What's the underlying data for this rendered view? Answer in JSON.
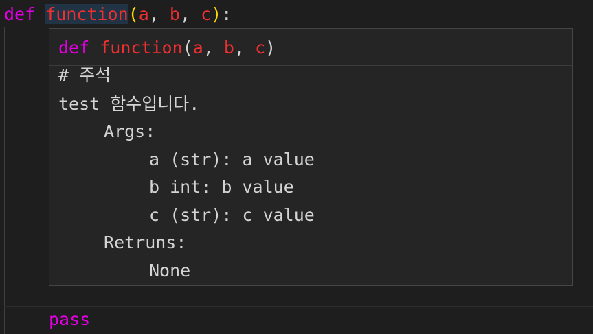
{
  "editor": {
    "line1": {
      "keyword": "def",
      "function_name": "function",
      "open_paren": "(",
      "params": [
        "a",
        "b",
        "c"
      ],
      "comma": ",",
      "close_paren": ")",
      "colon": ":"
    },
    "docstring_close": "\"\"\"",
    "pass_line": "pass"
  },
  "hover": {
    "signature": {
      "keyword": "def",
      "function_name": "function",
      "open_paren": "(",
      "params": [
        "a",
        "b",
        "c"
      ],
      "comma": ",",
      "close_paren": ")"
    },
    "doc_lines": [
      "# 주석",
      "test 함수입니다.",
      "Args:",
      "a (str): a value",
      "b int: b value",
      "c (str): c value",
      "Retruns:",
      "None"
    ]
  },
  "colors": {
    "background": "#1e1e1e",
    "keyword": "#e000e0",
    "function_name": "#f03030",
    "bracket": "#ffd700",
    "hover_background": "#252526"
  }
}
